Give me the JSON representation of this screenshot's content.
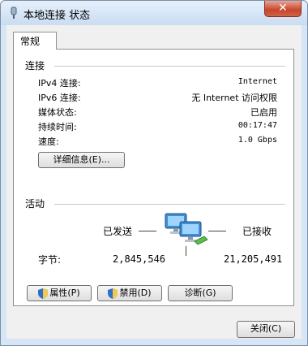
{
  "window": {
    "title": "本地连接 状态",
    "close_label": "✕"
  },
  "tabs": [
    {
      "label": "常规"
    }
  ],
  "connection": {
    "heading": "连接",
    "rows": [
      {
        "label": "IPv4 连接:",
        "value": "Internet"
      },
      {
        "label": "IPv6 连接:",
        "value": "无 Internet 访问权限"
      },
      {
        "label": "媒体状态:",
        "value": "已启用"
      },
      {
        "label": "持续时间:",
        "value": "00:17:47"
      },
      {
        "label": "速度:",
        "value": "1.0 Gbps"
      }
    ],
    "details_button": "详细信息(E)..."
  },
  "activity": {
    "heading": "活动",
    "sent_label": "已发送",
    "received_label": "已接收",
    "bytes_label": "字节:",
    "bytes_sent": "2,845,546",
    "bytes_received": "21,205,491"
  },
  "actions": {
    "properties": "属性(P)",
    "disable": "禁用(D)",
    "diagnose": "诊断(G)"
  },
  "footer": {
    "close": "关闭(C)"
  },
  "icons": {
    "title": "network-adapter-icon",
    "network": "network-computers-icon",
    "shield": "uac-shield-icon"
  },
  "colors": {
    "close_button": "#c7452b",
    "title_bar": "#c9dcf1"
  }
}
